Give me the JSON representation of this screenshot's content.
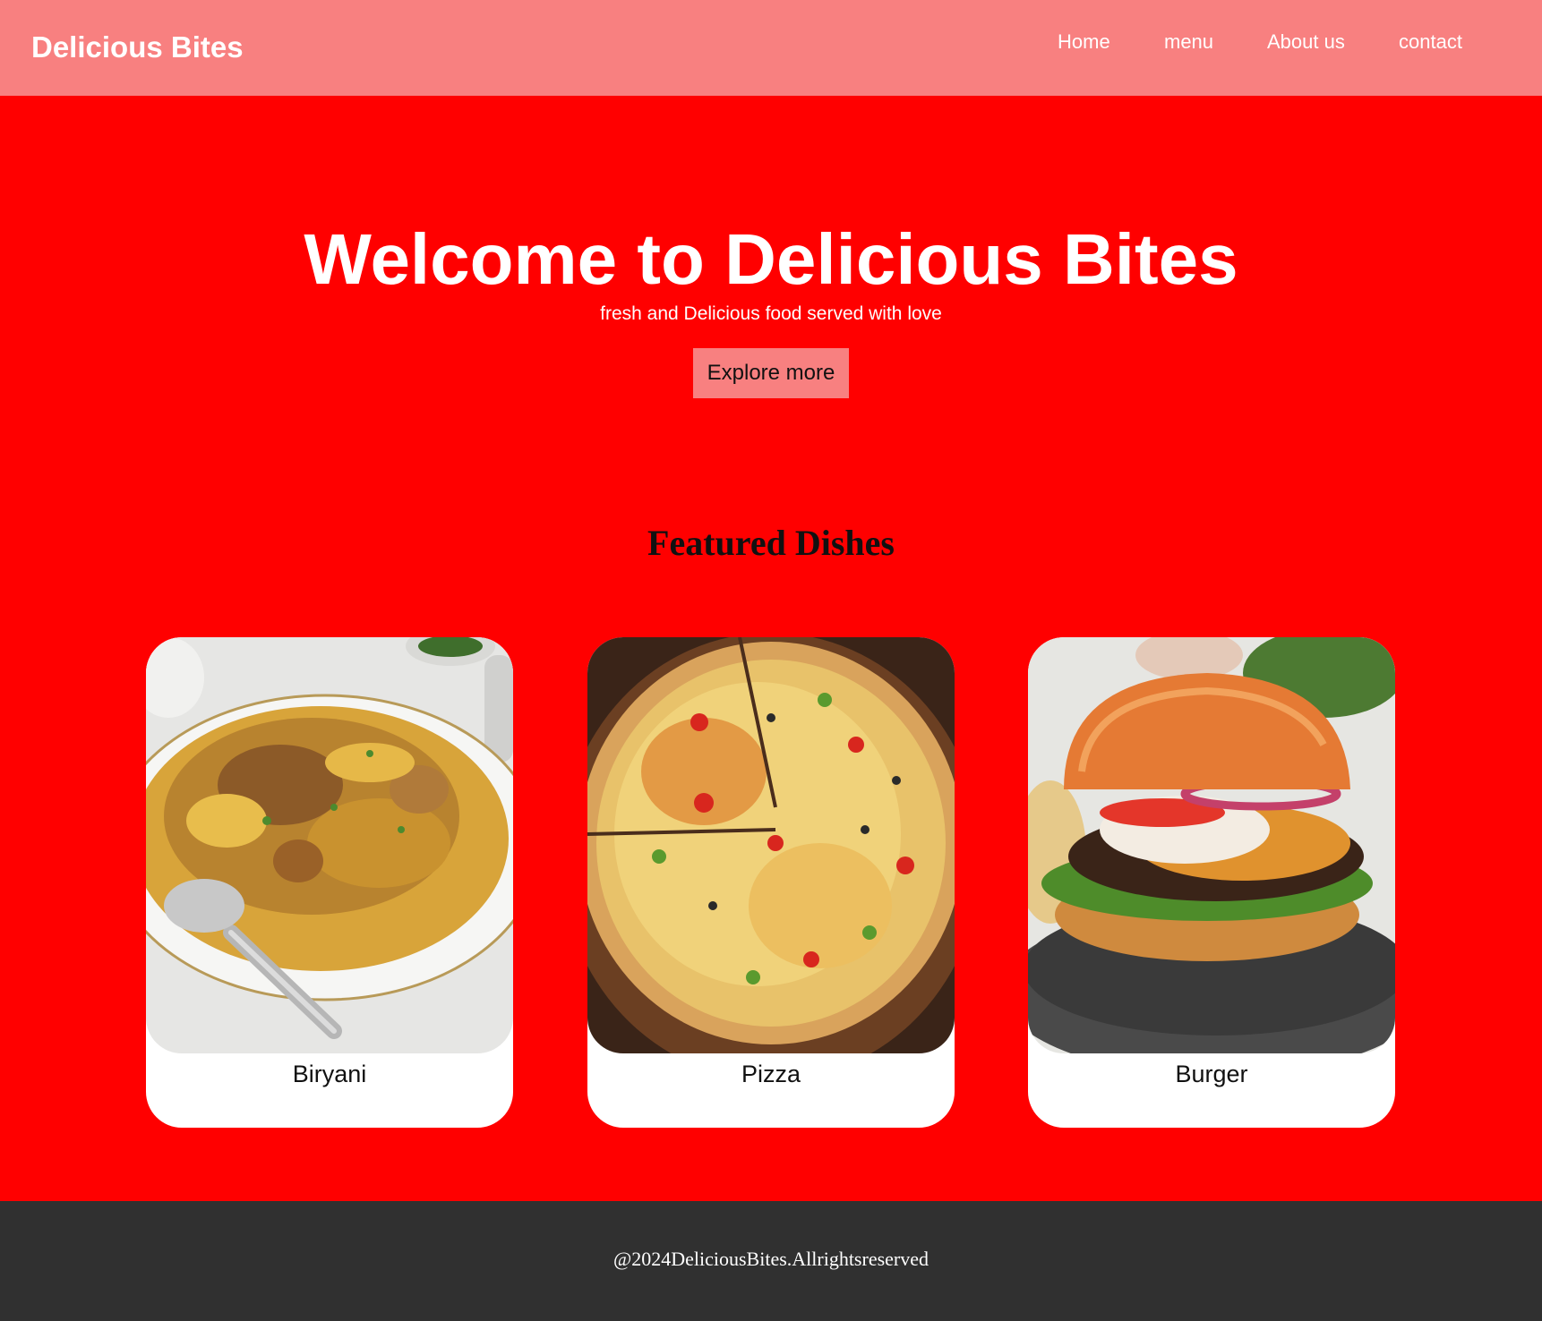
{
  "header": {
    "brand": "Delicious Bites",
    "nav": [
      "Home",
      "menu",
      "About us",
      "contact"
    ]
  },
  "hero": {
    "title": "Welcome to Delicious Bites",
    "subtitle": "fresh and Delicious food served with love",
    "button_label": "Explore more"
  },
  "featured": {
    "title": "Featured Dishes",
    "dishes": [
      {
        "name": "Biryani",
        "image": "biryani-photo"
      },
      {
        "name": "Pizza",
        "image": "pizza-photo"
      },
      {
        "name": "Burger",
        "image": "burger-photo"
      }
    ]
  },
  "footer": {
    "text": "@2024DeliciousBites.Allrightsreserved"
  },
  "colors": {
    "page_background": "#ff0000",
    "header_background": "#f88080",
    "button_background": "#f88080",
    "footer_background": "#303030",
    "card_background": "#ffffff"
  }
}
